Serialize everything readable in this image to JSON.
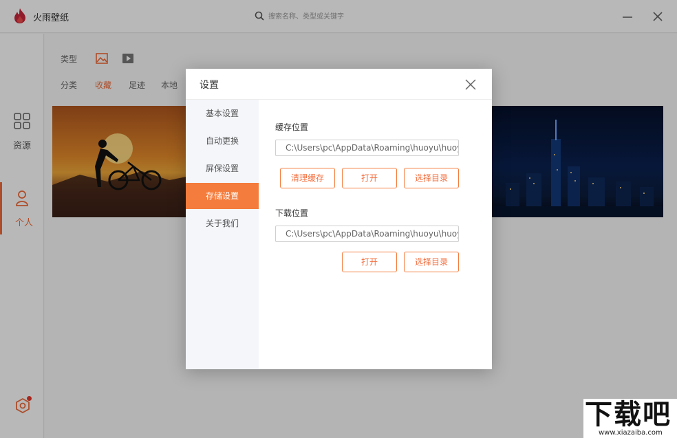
{
  "app": {
    "title": "火雨壁纸",
    "search_placeholder": "搜索名称、类型或关键字"
  },
  "nav": {
    "resources_label": "资源",
    "personal_label": "个人"
  },
  "main": {
    "type_label": "类型",
    "tabs": [
      "分类",
      "收藏",
      "足迹",
      "本地"
    ],
    "active_tab": "收藏"
  },
  "dialog": {
    "title": "设置",
    "menu": [
      "基本设置",
      "自动更换",
      "屏保设置",
      "存储设置",
      "关于我们"
    ],
    "active_menu": "存储设置",
    "cache": {
      "title": "缓存位置",
      "path": "C:\\Users\\pc\\AppData\\Roaming\\huoyu\\huoyu",
      "clear_label": "清理缓存",
      "open_label": "打开",
      "choose_label": "选择目录"
    },
    "download": {
      "title": "下载位置",
      "path": "C:\\Users\\pc\\AppData\\Roaming\\huoyu\\huoyu",
      "open_label": "打开",
      "choose_label": "选择目录"
    }
  },
  "watermark": {
    "brand": "下载吧",
    "url": "www.xiazaiba.com"
  },
  "colors": {
    "accent": "#f26b3a",
    "accent_fill": "#f47c3c"
  }
}
